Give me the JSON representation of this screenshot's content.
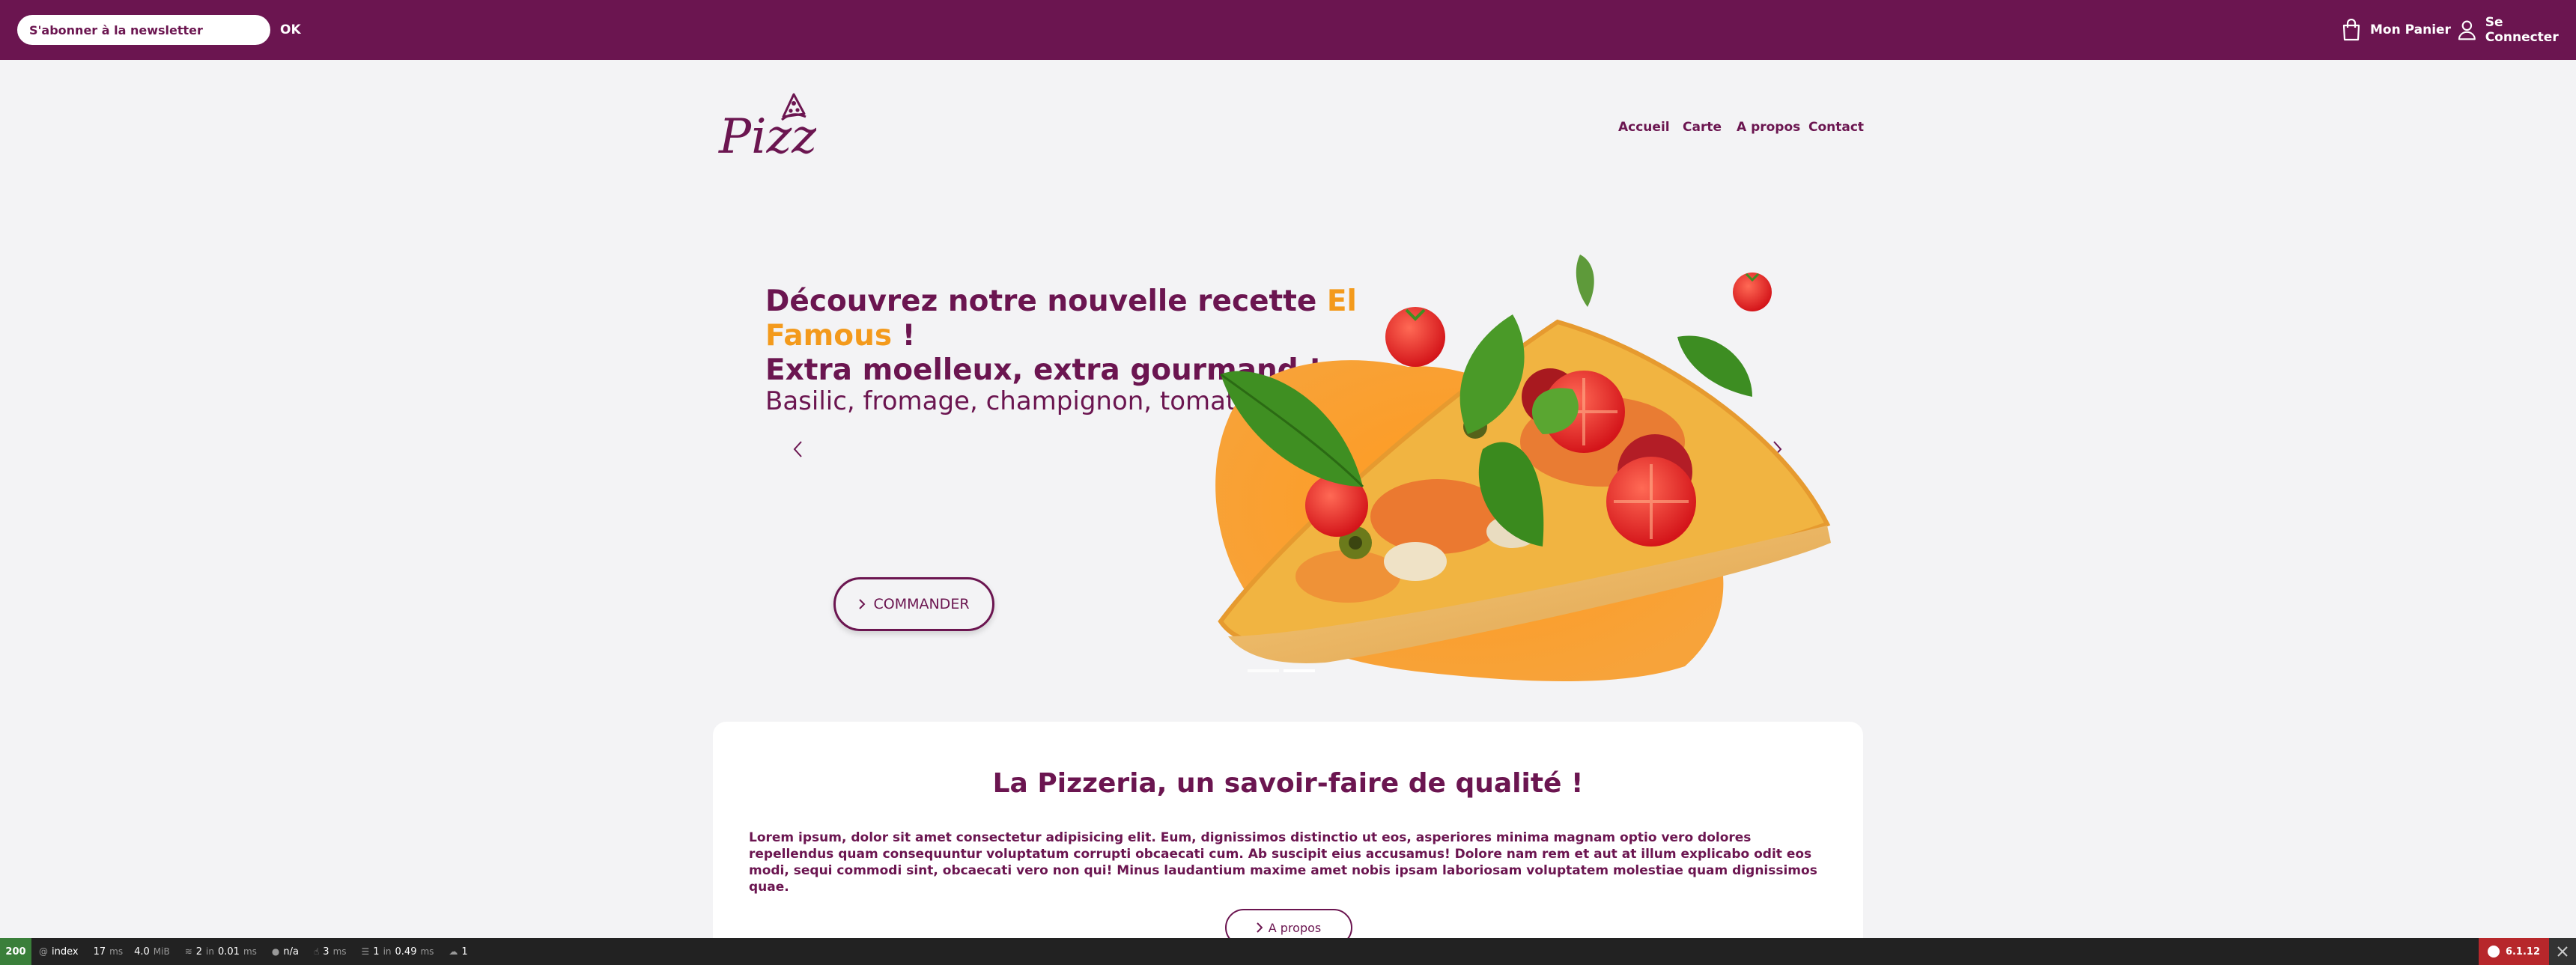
{
  "topbar": {
    "newsletter_placeholder": "S'abonner à la newsletter",
    "ok_label": "OK",
    "cart_label": "Mon Panier",
    "login_label": "Se Connecter"
  },
  "logo": {
    "text": "Pizza"
  },
  "nav": [
    {
      "label": "Accueil"
    },
    {
      "label": "Carte"
    },
    {
      "label": "A propos"
    },
    {
      "label": "Contact"
    }
  ],
  "hero": {
    "title_part1": "Découvrez notre nouvelle recette ",
    "title_accent": "El Famous",
    "title_part2": " !",
    "title_line2": "Extra moelleux, extra gourmand !",
    "subtitle": "Basilic, fromage, champignon, tomate",
    "cta_label": "COMMANDER"
  },
  "about": {
    "title": "La Pizzeria, un savoir-faire de qualité !",
    "text": "Lorem ipsum, dolor sit amet consectetur adipisicing elit. Eum, dignissimos distinctio ut eos, asperiores minima magnam optio vero dolores repellendus quam consequuntur voluptatum corrupti obcaecati cum. Ab suscipit eius accusamus! Dolore nam rem et aut at illum explicabo odit eos modi, sequi commodi sint, obcaecati vero non qui! Minus laudantium maxime amet nobis ipsam laboriosam voluptatem molestiae quam dignissimos quae.",
    "button_label": "A propos"
  },
  "debug": {
    "status": "200",
    "route": "index",
    "time": "17",
    "time_unit": "ms",
    "memory": "4.0",
    "memory_unit": "MiB",
    "cache_count": "2",
    "cache_in": "in",
    "cache_time": "0.01",
    "cache_unit": "ms",
    "user": "n/a",
    "events_time": "3",
    "events_unit": "ms",
    "db_count": "1",
    "db_in": "in",
    "db_time": "0.49",
    "db_unit": "ms",
    "assets": "1",
    "version": "6.1.12"
  },
  "colors": {
    "brand": "#6b1550",
    "accent": "#f39a1c",
    "background": "#f3f3f5"
  }
}
